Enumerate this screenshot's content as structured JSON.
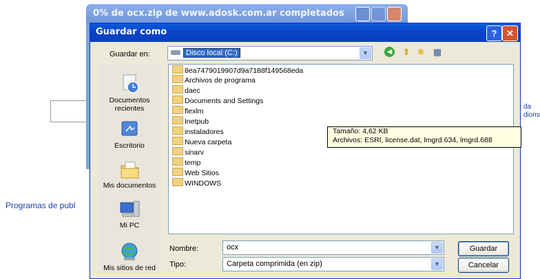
{
  "background": {
    "link_text": "Programas de publ",
    "right_text_1": "da",
    "right_text_2": "dioma"
  },
  "progress_window": {
    "title": "0% de ocx.zip de www.adosk.com.ar completados"
  },
  "dialog": {
    "title": "Guardar como",
    "help_label": "?",
    "close_label": "✕",
    "save_in_label": "Guardar en:",
    "save_in_value": "Disco local (C:)",
    "places": [
      {
        "label": "Documentos recientes",
        "icon": "recent-documents-icon"
      },
      {
        "label": "Escritorio",
        "icon": "desktop-icon"
      },
      {
        "label": "Mis documentos",
        "icon": "my-documents-icon"
      },
      {
        "label": "Mi PC",
        "icon": "my-computer-icon"
      },
      {
        "label": "Mis sitios de red",
        "icon": "network-places-icon"
      }
    ],
    "files": [
      "8ea7479019907d9a7188f149568eda",
      "Archivos de programa",
      "daec",
      "Documents and Settings",
      "flexlm",
      "Inetpub",
      "instaladores",
      "Nueva carpeta",
      "sinarv",
      "temp",
      "Web Sitios",
      "WINDOWS"
    ],
    "tooltip": {
      "line1": "Tamaño: 4,62 KB",
      "line2": "Archivos: ESRI, license.dat, lmgrd.634, lmgrd.688"
    },
    "name_label": "Nombre:",
    "name_value": "ocx",
    "type_label": "Tipo:",
    "type_value": "Carpeta comprimida (en zip)",
    "save_button": "Guardar",
    "cancel_button": "Cancelar"
  }
}
